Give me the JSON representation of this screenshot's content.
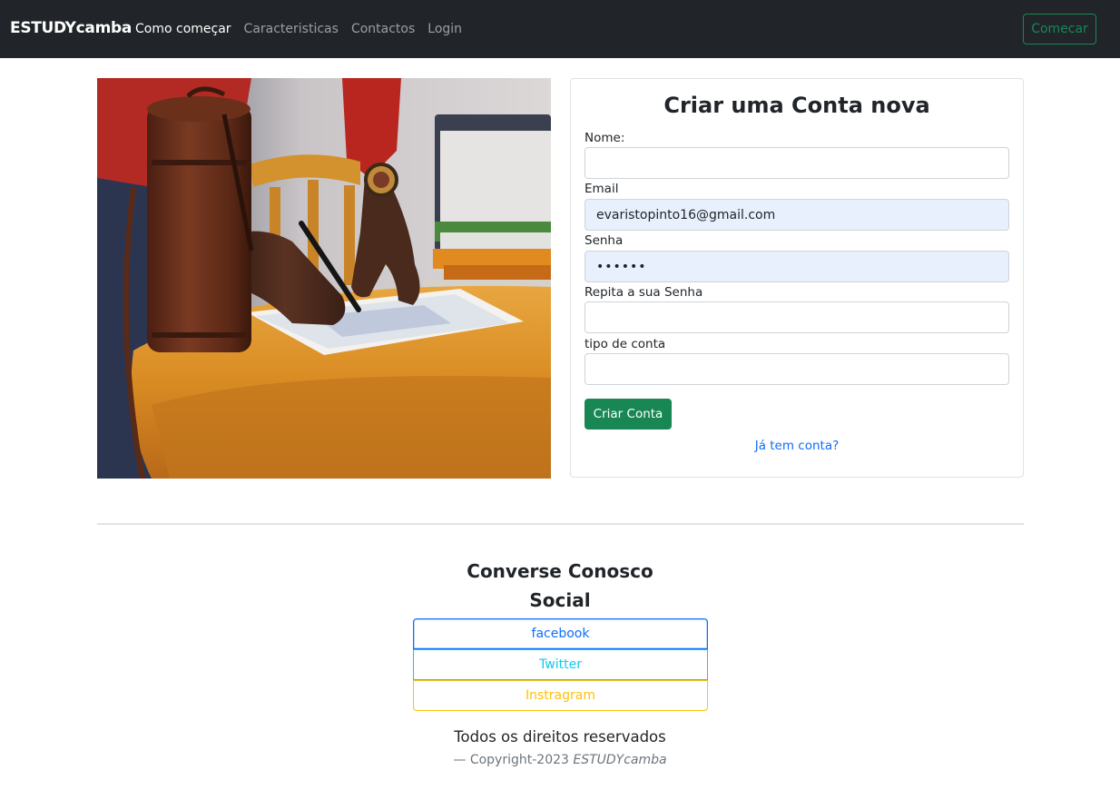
{
  "navbar": {
    "brand": "ESTUDYcamba",
    "links": [
      "Como começar",
      "Caracteristicas",
      "Contactos",
      "Login"
    ],
    "start_button": "Comecar"
  },
  "form": {
    "title": "Criar uma Conta nova",
    "name_label": "Nome:",
    "name_value": "",
    "email_label": "Email",
    "email_value": "evaristopinto16@gmail.com",
    "password_label": "Senha",
    "password_value": "••••••",
    "repeat_label": "Repita a sua Senha",
    "repeat_value": "",
    "account_type_label": "tipo de conta",
    "account_type_value": "",
    "submit_label": "Criar Conta",
    "login_link": "Já tem conta?"
  },
  "footer": {
    "heading": "Converse Conosco",
    "social_heading": "Social",
    "social_links": [
      "facebook",
      "Twitter",
      "Instragram"
    ],
    "rights": "Todos os direitos reservados",
    "copyright_prefix": "— Copyright-2023",
    "copyright_brand": "ESTUDYcamba"
  },
  "colors": {
    "navbar_bg": "#212529",
    "success": "#198754",
    "link": "#0d6efd",
    "facebook": "#0d6efd",
    "twitter": "#0dcaf0",
    "instagram": "#ffc107",
    "autofill_bg": "#e8f0fe"
  }
}
